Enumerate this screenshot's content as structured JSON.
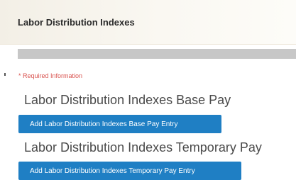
{
  "header": {
    "title": "Labor Distribution Indexes"
  },
  "form": {
    "required_note": "* Required Information",
    "sections": [
      {
        "title": "Labor Distribution Indexes Base Pay",
        "button_label": "Add Labor Distribution Indexes Base Pay Entry"
      },
      {
        "title": "Labor Distribution Indexes Temporary Pay",
        "button_label": "Add Labor Distribution Indexes Temporary Pay Entry"
      }
    ]
  },
  "colors": {
    "header_bg": "#f6f3eb",
    "progress_bar": "#c7c7c7",
    "required_text": "#d9534f",
    "button_bg": "#1f7fc4",
    "button_text": "#ffffff"
  }
}
